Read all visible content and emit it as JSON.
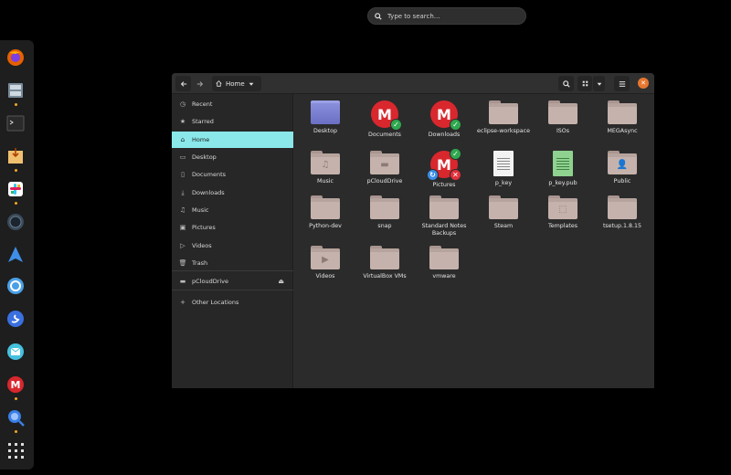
{
  "search": {
    "placeholder": "Type to search…"
  },
  "dock": {
    "apps": [
      {
        "name": "firefox",
        "color": "#e66000",
        "running": false
      },
      {
        "name": "files",
        "color": "#7a8a9a",
        "running": true
      },
      {
        "name": "terminal",
        "color": "#333333",
        "running": false
      },
      {
        "name": "installer",
        "color": "#f0c070",
        "running": true
      },
      {
        "name": "slack",
        "color": "#ffffff",
        "running": true
      },
      {
        "name": "camera",
        "color": "#3a4a5a",
        "running": false
      },
      {
        "name": "send",
        "color": "#3f8fe6",
        "running": false
      },
      {
        "name": "settings",
        "color": "#4aa0e6",
        "running": false
      },
      {
        "name": "simplenote",
        "color": "#3a70e0",
        "running": false
      },
      {
        "name": "mail",
        "color": "#45c1e0",
        "running": false
      },
      {
        "name": "mega",
        "color": "#d9272e",
        "running": true
      },
      {
        "name": "search-tool",
        "color": "#3a7fe6",
        "running": true
      },
      {
        "name": "app-grid",
        "color": "#dddddd",
        "running": false
      }
    ]
  },
  "window": {
    "path_label": "Home",
    "accent": "#8ae8ea",
    "close_color": "#e7772e",
    "close_glyph": "✕"
  },
  "sidebar": {
    "items": [
      {
        "label": "Recent",
        "icon": "clock-icon",
        "glyph": "◷"
      },
      {
        "label": "Starred",
        "icon": "star-icon",
        "glyph": "★"
      },
      {
        "label": "Home",
        "icon": "home-icon",
        "glyph": "⌂",
        "active": true
      },
      {
        "label": "Desktop",
        "icon": "desktop-icon",
        "glyph": "▭"
      },
      {
        "label": "Documents",
        "icon": "document-icon",
        "glyph": "▯"
      },
      {
        "label": "Downloads",
        "icon": "download-icon",
        "glyph": "⤓"
      },
      {
        "label": "Music",
        "icon": "music-icon",
        "glyph": "♫"
      },
      {
        "label": "Pictures",
        "icon": "picture-icon",
        "glyph": "▣"
      },
      {
        "label": "Videos",
        "icon": "video-icon",
        "glyph": "▷"
      },
      {
        "label": "Trash",
        "icon": "trash-icon",
        "glyph": "🗑"
      },
      {
        "label": "pCloudDrive",
        "icon": "drive-icon",
        "glyph": "▬"
      },
      {
        "label": "Other Locations",
        "icon": "plus-icon",
        "glyph": "+"
      }
    ]
  },
  "files": [
    {
      "label": "Desktop",
      "kind": "desktop"
    },
    {
      "label": "Documents",
      "kind": "mega-check"
    },
    {
      "label": "Downloads",
      "kind": "mega-check"
    },
    {
      "label": "eclipse-workspace",
      "kind": "folder"
    },
    {
      "label": "ISOs",
      "kind": "folder"
    },
    {
      "label": "MEGAsync",
      "kind": "folder"
    },
    {
      "label": "Music",
      "kind": "folder-music"
    },
    {
      "label": "pCloudDrive",
      "kind": "folder-drive"
    },
    {
      "label": "Pictures",
      "kind": "mega-multi"
    },
    {
      "label": "p_key",
      "kind": "doc"
    },
    {
      "label": "p_key.pub",
      "kind": "doc-green"
    },
    {
      "label": "Public",
      "kind": "folder-public"
    },
    {
      "label": "Python-dev",
      "kind": "folder"
    },
    {
      "label": "snap",
      "kind": "folder"
    },
    {
      "label": "Standard Notes Backups",
      "kind": "folder"
    },
    {
      "label": "Steam",
      "kind": "folder"
    },
    {
      "label": "Templates",
      "kind": "folder-templates"
    },
    {
      "label": "tsetup.1.8.15",
      "kind": "folder"
    },
    {
      "label": "Videos",
      "kind": "folder-video"
    },
    {
      "label": "VirtualBox VMs",
      "kind": "folder"
    },
    {
      "label": "vmware",
      "kind": "folder"
    }
  ]
}
